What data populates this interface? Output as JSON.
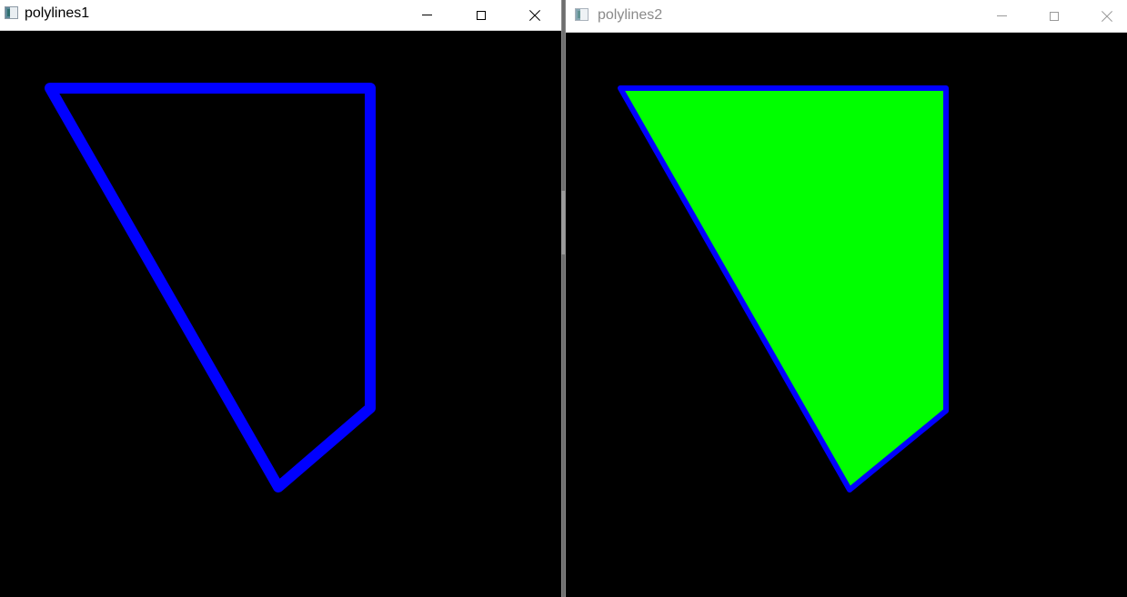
{
  "windows": [
    {
      "title": "polylines1",
      "active": true,
      "buttons": {
        "minimize": "minimize-icon",
        "maximize": "maximize-icon",
        "close": "close-icon"
      },
      "canvas": {
        "background": "#000000",
        "stroke_color": "#0000ff",
        "fill_color": null
      }
    },
    {
      "title": "polylines2",
      "active": false,
      "buttons": {
        "minimize": "minimize-icon",
        "maximize": "maximize-icon",
        "close": "close-icon"
      },
      "canvas": {
        "background": "#000000",
        "stroke_color": "#0000ff",
        "fill_color": "#00ff00"
      }
    }
  ]
}
